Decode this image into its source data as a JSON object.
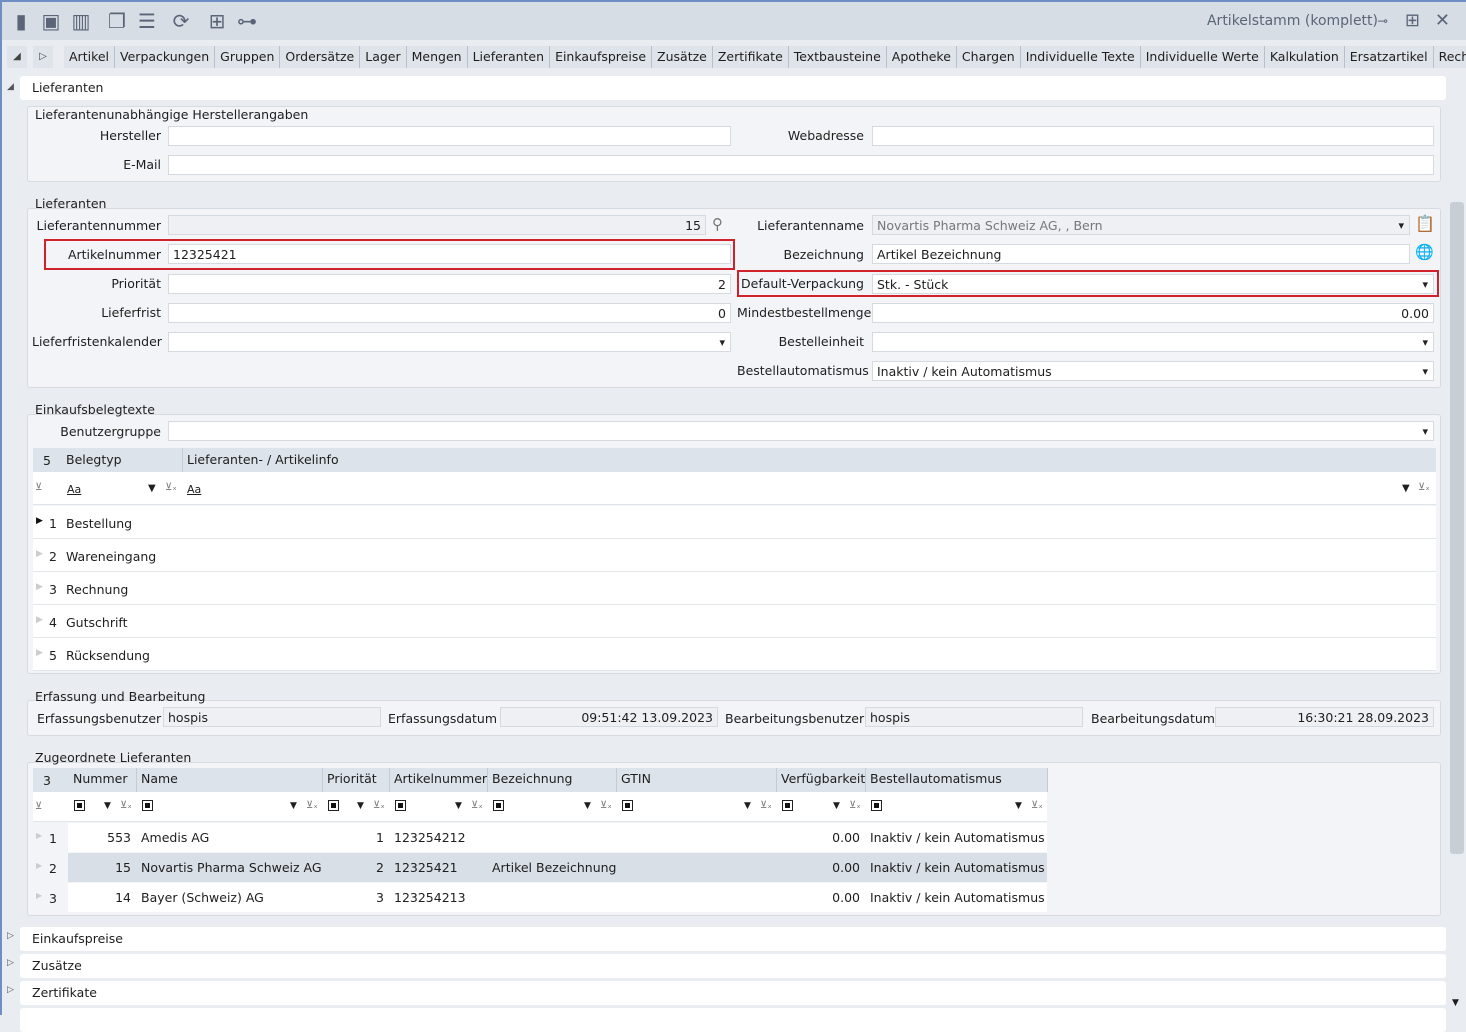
{
  "window": {
    "title": "Artikelstamm (komplett)"
  },
  "toolbar": {
    "icons": [
      "new-document-icon",
      "save-icon",
      "delete-icon",
      "copy-icon",
      "list-icon",
      "refresh-icon",
      "structure-icon",
      "hierarchy-icon"
    ]
  },
  "tabs": [
    "Artikel",
    "Verpackungen",
    "Gruppen",
    "Ordersätze",
    "Lager",
    "Mengen",
    "Lieferanten",
    "Einkaufspreise",
    "Zusätze",
    "Zertifikate",
    "Textbausteine",
    "Apotheke",
    "Chargen",
    "Individuelle Texte",
    "Individuelle Werte",
    "Kalkulation",
    "Ersatzartikel",
    "Rechte"
  ],
  "section": {
    "title": "Lieferanten"
  },
  "hersteller": {
    "group": "Lieferantenunabhängige Herstellerangaben",
    "hersteller_label": "Hersteller",
    "hersteller_value": "",
    "web_label": "Webadresse",
    "web_value": "",
    "email_label": "E-Mail",
    "email_value": ""
  },
  "lieferanten": {
    "group": "Lieferanten",
    "nummer_label": "Lieferantennummer",
    "nummer": "15",
    "artikelnr_label": "Artikelnummer",
    "artikelnr": "12325421",
    "prio_label": "Priorität",
    "prio": "2",
    "frist_label": "Lieferfrist",
    "frist": "0",
    "kal_label": "Lieferfristenkalender",
    "kal": "",
    "name_label": "Lieferantenname",
    "name": "Novartis Pharma Schweiz AG, , Bern",
    "bez_label": "Bezeichnung",
    "bez": "Artikel Bezeichnung",
    "verp_label": "Default-Verpackung",
    "verp": "Stk. - Stück",
    "mbm_label": "Mindestbestellmenge",
    "mbm": "0.00",
    "be_label": "Bestelleinheit",
    "be": "",
    "ba_label": "Bestellautomatismus",
    "ba": "Inaktiv / kein Automatismus"
  },
  "texte": {
    "group": "Einkaufsbelegtexte",
    "bg_label": "Benutzergruppe",
    "bg": "",
    "count": "5",
    "col1": "Belegtyp",
    "col2": "Lieferanten- / Artikelinfo",
    "filter": "Aa",
    "rows": [
      {
        "n": "1",
        "t": "Bestellung"
      },
      {
        "n": "2",
        "t": "Wareneingang"
      },
      {
        "n": "3",
        "t": "Rechnung"
      },
      {
        "n": "4",
        "t": "Gutschrift"
      },
      {
        "n": "5",
        "t": "Rücksendung"
      }
    ]
  },
  "erfassung": {
    "group": "Erfassung und Bearbeitung",
    "eb_label": "Erfassungsbenutzer",
    "eb": "hospis",
    "ed_label": "Erfassungsdatum",
    "ed": "09:51:42 13.09.2023",
    "bb_label": "Bearbeitungsbenutzer",
    "bb": "hospis",
    "bd_label": "Bearbeitungsdatum",
    "bd": "16:30:21 28.09.2023"
  },
  "zugeordnet": {
    "group": "Zugeordnete Lieferanten",
    "count": "3",
    "cols": [
      "Nummer",
      "Name",
      "Priorität",
      "Artikelnummer",
      "Bezeichnung",
      "GTIN",
      "Verfügbarkeit",
      "Bestellautomatismus"
    ],
    "rows": [
      {
        "i": "1",
        "nr": "553",
        "name": "Amedis AG",
        "prio": "1",
        "art": "123254212",
        "bez": "",
        "gtin": "",
        "verf": "0.00",
        "ba": "Inaktiv / kein Automatismus"
      },
      {
        "i": "2",
        "nr": "15",
        "name": "Novartis Pharma Schweiz AG",
        "prio": "2",
        "art": "12325421",
        "bez": "Artikel Bezeichnung",
        "gtin": "",
        "verf": "0.00",
        "ba": "Inaktiv / kein Automatismus"
      },
      {
        "i": "3",
        "nr": "14",
        "name": "Bayer (Schweiz) AG",
        "prio": "3",
        "art": "123254213",
        "bez": "",
        "gtin": "",
        "verf": "0.00",
        "ba": "Inaktiv / kein Automatismus"
      }
    ]
  },
  "collapsed": [
    "Einkaufspreise",
    "Zusätze",
    "Zertifikate"
  ]
}
